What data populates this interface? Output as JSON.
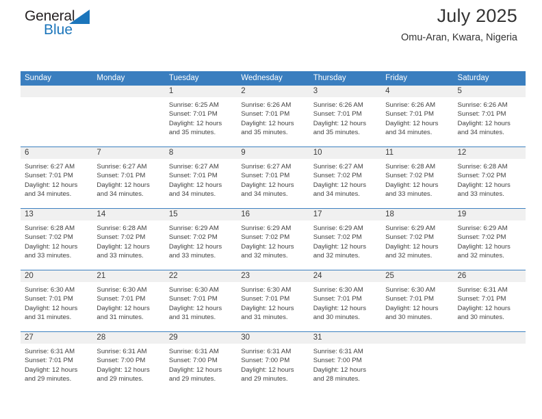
{
  "brand": {
    "word_one": "General",
    "word_two": "Blue",
    "triangle_icon": "triangle-icon",
    "accent_color": "#1b75bb"
  },
  "header": {
    "title": "July 2025",
    "location": "Omu-Aran, Kwara, Nigeria"
  },
  "calendar": {
    "header_bg": "#3a7ebf",
    "date_band_bg": "#f0f0f0",
    "day_headers": [
      "Sunday",
      "Monday",
      "Tuesday",
      "Wednesday",
      "Thursday",
      "Friday",
      "Saturday"
    ],
    "weeks": [
      [
        {
          "date": "",
          "lines": []
        },
        {
          "date": "",
          "lines": []
        },
        {
          "date": "1",
          "lines": [
            "Sunrise: 6:25 AM",
            "Sunset: 7:01 PM",
            "Daylight: 12 hours",
            "and 35 minutes."
          ]
        },
        {
          "date": "2",
          "lines": [
            "Sunrise: 6:26 AM",
            "Sunset: 7:01 PM",
            "Daylight: 12 hours",
            "and 35 minutes."
          ]
        },
        {
          "date": "3",
          "lines": [
            "Sunrise: 6:26 AM",
            "Sunset: 7:01 PM",
            "Daylight: 12 hours",
            "and 35 minutes."
          ]
        },
        {
          "date": "4",
          "lines": [
            "Sunrise: 6:26 AM",
            "Sunset: 7:01 PM",
            "Daylight: 12 hours",
            "and 34 minutes."
          ]
        },
        {
          "date": "5",
          "lines": [
            "Sunrise: 6:26 AM",
            "Sunset: 7:01 PM",
            "Daylight: 12 hours",
            "and 34 minutes."
          ]
        }
      ],
      [
        {
          "date": "6",
          "lines": [
            "Sunrise: 6:27 AM",
            "Sunset: 7:01 PM",
            "Daylight: 12 hours",
            "and 34 minutes."
          ]
        },
        {
          "date": "7",
          "lines": [
            "Sunrise: 6:27 AM",
            "Sunset: 7:01 PM",
            "Daylight: 12 hours",
            "and 34 minutes."
          ]
        },
        {
          "date": "8",
          "lines": [
            "Sunrise: 6:27 AM",
            "Sunset: 7:01 PM",
            "Daylight: 12 hours",
            "and 34 minutes."
          ]
        },
        {
          "date": "9",
          "lines": [
            "Sunrise: 6:27 AM",
            "Sunset: 7:01 PM",
            "Daylight: 12 hours",
            "and 34 minutes."
          ]
        },
        {
          "date": "10",
          "lines": [
            "Sunrise: 6:27 AM",
            "Sunset: 7:02 PM",
            "Daylight: 12 hours",
            "and 34 minutes."
          ]
        },
        {
          "date": "11",
          "lines": [
            "Sunrise: 6:28 AM",
            "Sunset: 7:02 PM",
            "Daylight: 12 hours",
            "and 33 minutes."
          ]
        },
        {
          "date": "12",
          "lines": [
            "Sunrise: 6:28 AM",
            "Sunset: 7:02 PM",
            "Daylight: 12 hours",
            "and 33 minutes."
          ]
        }
      ],
      [
        {
          "date": "13",
          "lines": [
            "Sunrise: 6:28 AM",
            "Sunset: 7:02 PM",
            "Daylight: 12 hours",
            "and 33 minutes."
          ]
        },
        {
          "date": "14",
          "lines": [
            "Sunrise: 6:28 AM",
            "Sunset: 7:02 PM",
            "Daylight: 12 hours",
            "and 33 minutes."
          ]
        },
        {
          "date": "15",
          "lines": [
            "Sunrise: 6:29 AM",
            "Sunset: 7:02 PM",
            "Daylight: 12 hours",
            "and 33 minutes."
          ]
        },
        {
          "date": "16",
          "lines": [
            "Sunrise: 6:29 AM",
            "Sunset: 7:02 PM",
            "Daylight: 12 hours",
            "and 32 minutes."
          ]
        },
        {
          "date": "17",
          "lines": [
            "Sunrise: 6:29 AM",
            "Sunset: 7:02 PM",
            "Daylight: 12 hours",
            "and 32 minutes."
          ]
        },
        {
          "date": "18",
          "lines": [
            "Sunrise: 6:29 AM",
            "Sunset: 7:02 PM",
            "Daylight: 12 hours",
            "and 32 minutes."
          ]
        },
        {
          "date": "19",
          "lines": [
            "Sunrise: 6:29 AM",
            "Sunset: 7:02 PM",
            "Daylight: 12 hours",
            "and 32 minutes."
          ]
        }
      ],
      [
        {
          "date": "20",
          "lines": [
            "Sunrise: 6:30 AM",
            "Sunset: 7:01 PM",
            "Daylight: 12 hours",
            "and 31 minutes."
          ]
        },
        {
          "date": "21",
          "lines": [
            "Sunrise: 6:30 AM",
            "Sunset: 7:01 PM",
            "Daylight: 12 hours",
            "and 31 minutes."
          ]
        },
        {
          "date": "22",
          "lines": [
            "Sunrise: 6:30 AM",
            "Sunset: 7:01 PM",
            "Daylight: 12 hours",
            "and 31 minutes."
          ]
        },
        {
          "date": "23",
          "lines": [
            "Sunrise: 6:30 AM",
            "Sunset: 7:01 PM",
            "Daylight: 12 hours",
            "and 31 minutes."
          ]
        },
        {
          "date": "24",
          "lines": [
            "Sunrise: 6:30 AM",
            "Sunset: 7:01 PM",
            "Daylight: 12 hours",
            "and 30 minutes."
          ]
        },
        {
          "date": "25",
          "lines": [
            "Sunrise: 6:30 AM",
            "Sunset: 7:01 PM",
            "Daylight: 12 hours",
            "and 30 minutes."
          ]
        },
        {
          "date": "26",
          "lines": [
            "Sunrise: 6:31 AM",
            "Sunset: 7:01 PM",
            "Daylight: 12 hours",
            "and 30 minutes."
          ]
        }
      ],
      [
        {
          "date": "27",
          "lines": [
            "Sunrise: 6:31 AM",
            "Sunset: 7:01 PM",
            "Daylight: 12 hours",
            "and 29 minutes."
          ]
        },
        {
          "date": "28",
          "lines": [
            "Sunrise: 6:31 AM",
            "Sunset: 7:00 PM",
            "Daylight: 12 hours",
            "and 29 minutes."
          ]
        },
        {
          "date": "29",
          "lines": [
            "Sunrise: 6:31 AM",
            "Sunset: 7:00 PM",
            "Daylight: 12 hours",
            "and 29 minutes."
          ]
        },
        {
          "date": "30",
          "lines": [
            "Sunrise: 6:31 AM",
            "Sunset: 7:00 PM",
            "Daylight: 12 hours",
            "and 29 minutes."
          ]
        },
        {
          "date": "31",
          "lines": [
            "Sunrise: 6:31 AM",
            "Sunset: 7:00 PM",
            "Daylight: 12 hours",
            "and 28 minutes."
          ]
        },
        {
          "date": "",
          "lines": []
        },
        {
          "date": "",
          "lines": []
        }
      ]
    ]
  }
}
